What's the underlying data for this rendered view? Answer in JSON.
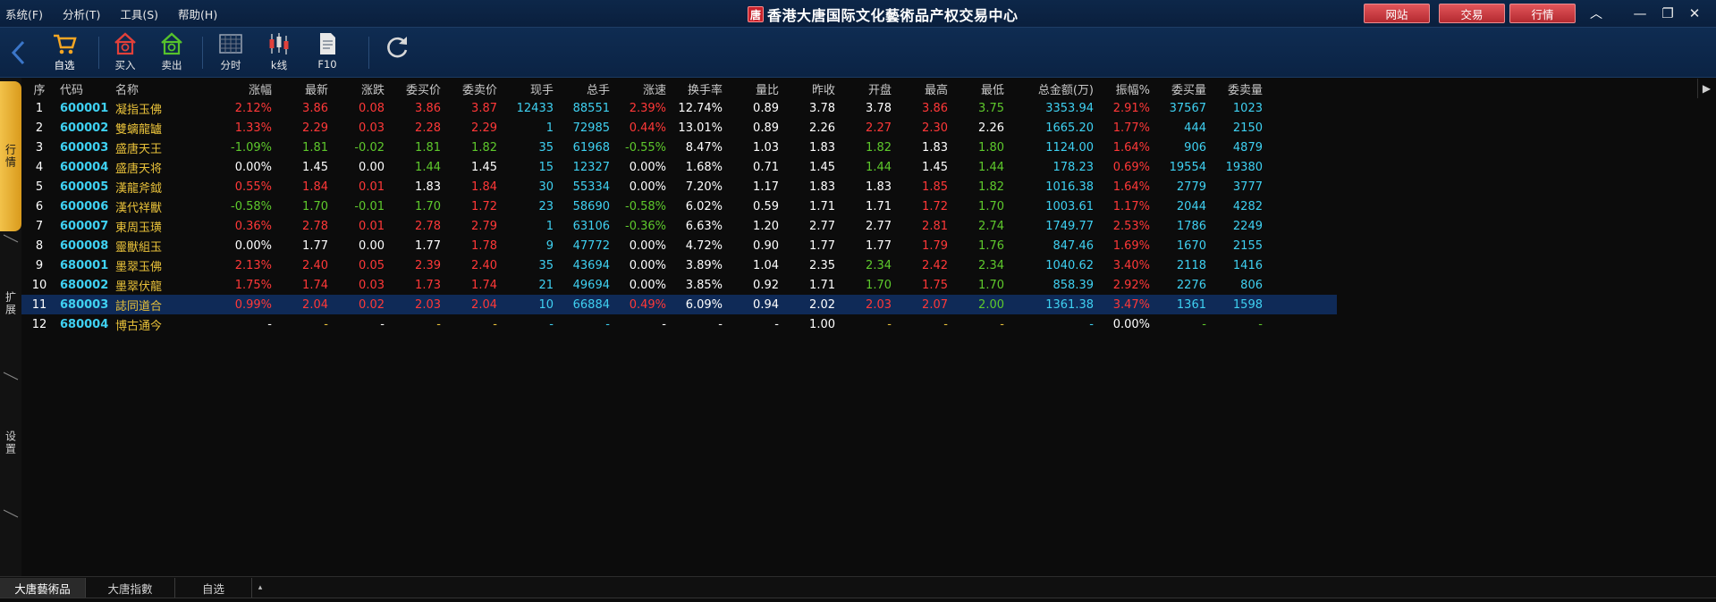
{
  "menu": [
    "系统(F)",
    "分析(T)",
    "工具(S)",
    "帮助(H)"
  ],
  "app": {
    "logo_char": "唐",
    "title": "香港大唐国际文化藝術品产权交易中心"
  },
  "title_buttons": [
    "网站",
    "交易",
    "行情"
  ],
  "window_controls": {
    "collapse": "︿",
    "minimize": "—",
    "restore": "❐",
    "close": "✕"
  },
  "toolbar": {
    "items": [
      {
        "label": "自选",
        "icon": "cart-icon"
      },
      {
        "label": "买入",
        "icon": "buy-icon"
      },
      {
        "label": "卖出",
        "icon": "sell-icon"
      },
      {
        "label": "分时",
        "icon": "timeshare-icon"
      },
      {
        "label": "k线",
        "icon": "kline-icon"
      },
      {
        "label": "F10",
        "icon": "document-icon"
      },
      {
        "label": "",
        "icon": "refresh-icon"
      }
    ]
  },
  "sidetabs": [
    "行情",
    "扩展",
    "设置"
  ],
  "grid": {
    "headers": [
      "序",
      "代码",
      "名称",
      "涨幅",
      "最新",
      "涨跌",
      "委买价",
      "委卖价",
      "现手",
      "总手",
      "涨速",
      "换手率",
      "量比",
      "昨收",
      "开盘",
      "最高",
      "最低",
      "总金额(万)",
      "振幅%",
      "委买量",
      "委卖量"
    ],
    "rows": [
      {
        "cells": [
          "1",
          "600001",
          "凝指玉佛",
          "2.12%",
          "3.86",
          "0.08",
          "3.86",
          "3.87",
          "12433",
          "88551",
          "2.39%",
          "12.74%",
          "0.89",
          "3.78",
          "3.78",
          "3.86",
          "3.75",
          "3353.94",
          "2.91%",
          "37567",
          "1023"
        ],
        "colors": [
          "wh",
          "cy",
          "yl",
          "up",
          "up",
          "up",
          "up",
          "up",
          "cy",
          "cy",
          "up",
          "wh",
          "wh",
          "wh",
          "wh",
          "up",
          "gr",
          "cy",
          "up",
          "cy",
          "cy"
        ]
      },
      {
        "cells": [
          "2",
          "600002",
          "雙螭龍罏",
          "1.33%",
          "2.29",
          "0.03",
          "2.28",
          "2.29",
          "1",
          "72985",
          "0.44%",
          "13.01%",
          "0.89",
          "2.26",
          "2.27",
          "2.30",
          "2.26",
          "1665.20",
          "1.77%",
          "444",
          "2150"
        ],
        "colors": [
          "wh",
          "cy",
          "yl",
          "up",
          "up",
          "up",
          "up",
          "up",
          "cy",
          "cy",
          "up",
          "wh",
          "wh",
          "wh",
          "up",
          "up",
          "wh",
          "cy",
          "up",
          "cy",
          "cy"
        ]
      },
      {
        "cells": [
          "3",
          "600003",
          "盛唐天王",
          "-1.09%",
          "1.81",
          "-0.02",
          "1.81",
          "1.82",
          "35",
          "61968",
          "-0.55%",
          "8.47%",
          "1.03",
          "1.83",
          "1.82",
          "1.83",
          "1.80",
          "1124.00",
          "1.64%",
          "906",
          "4879"
        ],
        "colors": [
          "wh",
          "cy",
          "yl",
          "gr",
          "gr",
          "gr",
          "gr",
          "gr",
          "cy",
          "cy",
          "gr",
          "wh",
          "wh",
          "wh",
          "gr",
          "wh",
          "gr",
          "cy",
          "up",
          "cy",
          "cy"
        ]
      },
      {
        "cells": [
          "4",
          "600004",
          "盛唐天将",
          "0.00%",
          "1.45",
          "0.00",
          "1.44",
          "1.45",
          "15",
          "12327",
          "0.00%",
          "1.68%",
          "0.71",
          "1.45",
          "1.44",
          "1.45",
          "1.44",
          "178.23",
          "0.69%",
          "19554",
          "19380"
        ],
        "colors": [
          "wh",
          "cy",
          "yl",
          "wh",
          "wh",
          "wh",
          "gr",
          "wh",
          "cy",
          "cy",
          "wh",
          "wh",
          "wh",
          "wh",
          "gr",
          "wh",
          "gr",
          "cy",
          "up",
          "cy",
          "cy"
        ]
      },
      {
        "cells": [
          "5",
          "600005",
          "漢龍斧鉞",
          "0.55%",
          "1.84",
          "0.01",
          "1.83",
          "1.84",
          "30",
          "55334",
          "0.00%",
          "7.20%",
          "1.17",
          "1.83",
          "1.83",
          "1.85",
          "1.82",
          "1016.38",
          "1.64%",
          "2779",
          "3777"
        ],
        "colors": [
          "wh",
          "cy",
          "yl",
          "up",
          "up",
          "up",
          "wh",
          "up",
          "cy",
          "cy",
          "wh",
          "wh",
          "wh",
          "wh",
          "wh",
          "up",
          "gr",
          "cy",
          "up",
          "cy",
          "cy"
        ]
      },
      {
        "cells": [
          "6",
          "600006",
          "漢代祥獸",
          "-0.58%",
          "1.70",
          "-0.01",
          "1.70",
          "1.72",
          "23",
          "58690",
          "-0.58%",
          "6.02%",
          "0.59",
          "1.71",
          "1.71",
          "1.72",
          "1.70",
          "1003.61",
          "1.17%",
          "2044",
          "4282"
        ],
        "colors": [
          "wh",
          "cy",
          "yl",
          "gr",
          "gr",
          "gr",
          "gr",
          "up",
          "cy",
          "cy",
          "gr",
          "wh",
          "wh",
          "wh",
          "wh",
          "up",
          "gr",
          "cy",
          "up",
          "cy",
          "cy"
        ]
      },
      {
        "cells": [
          "7",
          "600007",
          "東周玉璜",
          "0.36%",
          "2.78",
          "0.01",
          "2.78",
          "2.79",
          "1",
          "63106",
          "-0.36%",
          "6.63%",
          "1.20",
          "2.77",
          "2.77",
          "2.81",
          "2.74",
          "1749.77",
          "2.53%",
          "1786",
          "2249"
        ],
        "colors": [
          "wh",
          "cy",
          "yl",
          "up",
          "up",
          "up",
          "up",
          "up",
          "cy",
          "cy",
          "gr",
          "wh",
          "wh",
          "wh",
          "wh",
          "up",
          "gr",
          "cy",
          "up",
          "cy",
          "cy"
        ]
      },
      {
        "cells": [
          "8",
          "600008",
          "靈獸組玉",
          "0.00%",
          "1.77",
          "0.00",
          "1.77",
          "1.78",
          "9",
          "47772",
          "0.00%",
          "4.72%",
          "0.90",
          "1.77",
          "1.77",
          "1.79",
          "1.76",
          "847.46",
          "1.69%",
          "1670",
          "2155"
        ],
        "colors": [
          "wh",
          "cy",
          "yl",
          "wh",
          "wh",
          "wh",
          "wh",
          "up",
          "cy",
          "cy",
          "wh",
          "wh",
          "wh",
          "wh",
          "wh",
          "up",
          "gr",
          "cy",
          "up",
          "cy",
          "cy"
        ]
      },
      {
        "cells": [
          "9",
          "680001",
          "墨翠玉佛",
          "2.13%",
          "2.40",
          "0.05",
          "2.39",
          "2.40",
          "35",
          "43694",
          "0.00%",
          "3.89%",
          "1.04",
          "2.35",
          "2.34",
          "2.42",
          "2.34",
          "1040.62",
          "3.40%",
          "2118",
          "1416"
        ],
        "colors": [
          "wh",
          "cy",
          "yl",
          "up",
          "up",
          "up",
          "up",
          "up",
          "cy",
          "cy",
          "wh",
          "wh",
          "wh",
          "wh",
          "gr",
          "up",
          "gr",
          "cy",
          "up",
          "cy",
          "cy"
        ]
      },
      {
        "cells": [
          "10",
          "680002",
          "墨翠伏龍",
          "1.75%",
          "1.74",
          "0.03",
          "1.73",
          "1.74",
          "21",
          "49694",
          "0.00%",
          "3.85%",
          "0.92",
          "1.71",
          "1.70",
          "1.75",
          "1.70",
          "858.39",
          "2.92%",
          "2276",
          "806"
        ],
        "colors": [
          "wh",
          "cy",
          "yl",
          "up",
          "up",
          "up",
          "up",
          "up",
          "cy",
          "cy",
          "wh",
          "wh",
          "wh",
          "wh",
          "gr",
          "up",
          "gr",
          "cy",
          "up",
          "cy",
          "cy"
        ]
      },
      {
        "cells": [
          "11",
          "680003",
          "誌同道合",
          "0.99%",
          "2.04",
          "0.02",
          "2.03",
          "2.04",
          "10",
          "66884",
          "0.49%",
          "6.09%",
          "0.94",
          "2.02",
          "2.03",
          "2.07",
          "2.00",
          "1361.38",
          "3.47%",
          "1361",
          "1598"
        ],
        "colors": [
          "wh",
          "cy",
          "yl",
          "up",
          "up",
          "up",
          "up",
          "up",
          "cy",
          "cy",
          "up",
          "wh",
          "wh",
          "wh",
          "up",
          "up",
          "gr",
          "cy",
          "up",
          "cy",
          "cy"
        ],
        "selected": true
      },
      {
        "cells": [
          "12",
          "680004",
          "博古通今",
          "-",
          "-",
          "-",
          "-",
          "-",
          "-",
          "-",
          "-",
          "-",
          "-",
          "1.00",
          "-",
          "-",
          "-",
          "-",
          "0.00%",
          "-",
          "-"
        ],
        "colors": [
          "wh",
          "cy",
          "yl",
          "wh",
          "yl",
          "wh",
          "yl",
          "yl",
          "cy",
          "cy",
          "wh",
          "wh",
          "wh",
          "wh",
          "yl",
          "yl",
          "yl",
          "cy",
          "wh",
          "gr",
          "gr"
        ]
      }
    ]
  },
  "bottom_tabs": [
    "大唐藝術品",
    "大唐指數",
    "自选"
  ],
  "bottom_more": "▴"
}
